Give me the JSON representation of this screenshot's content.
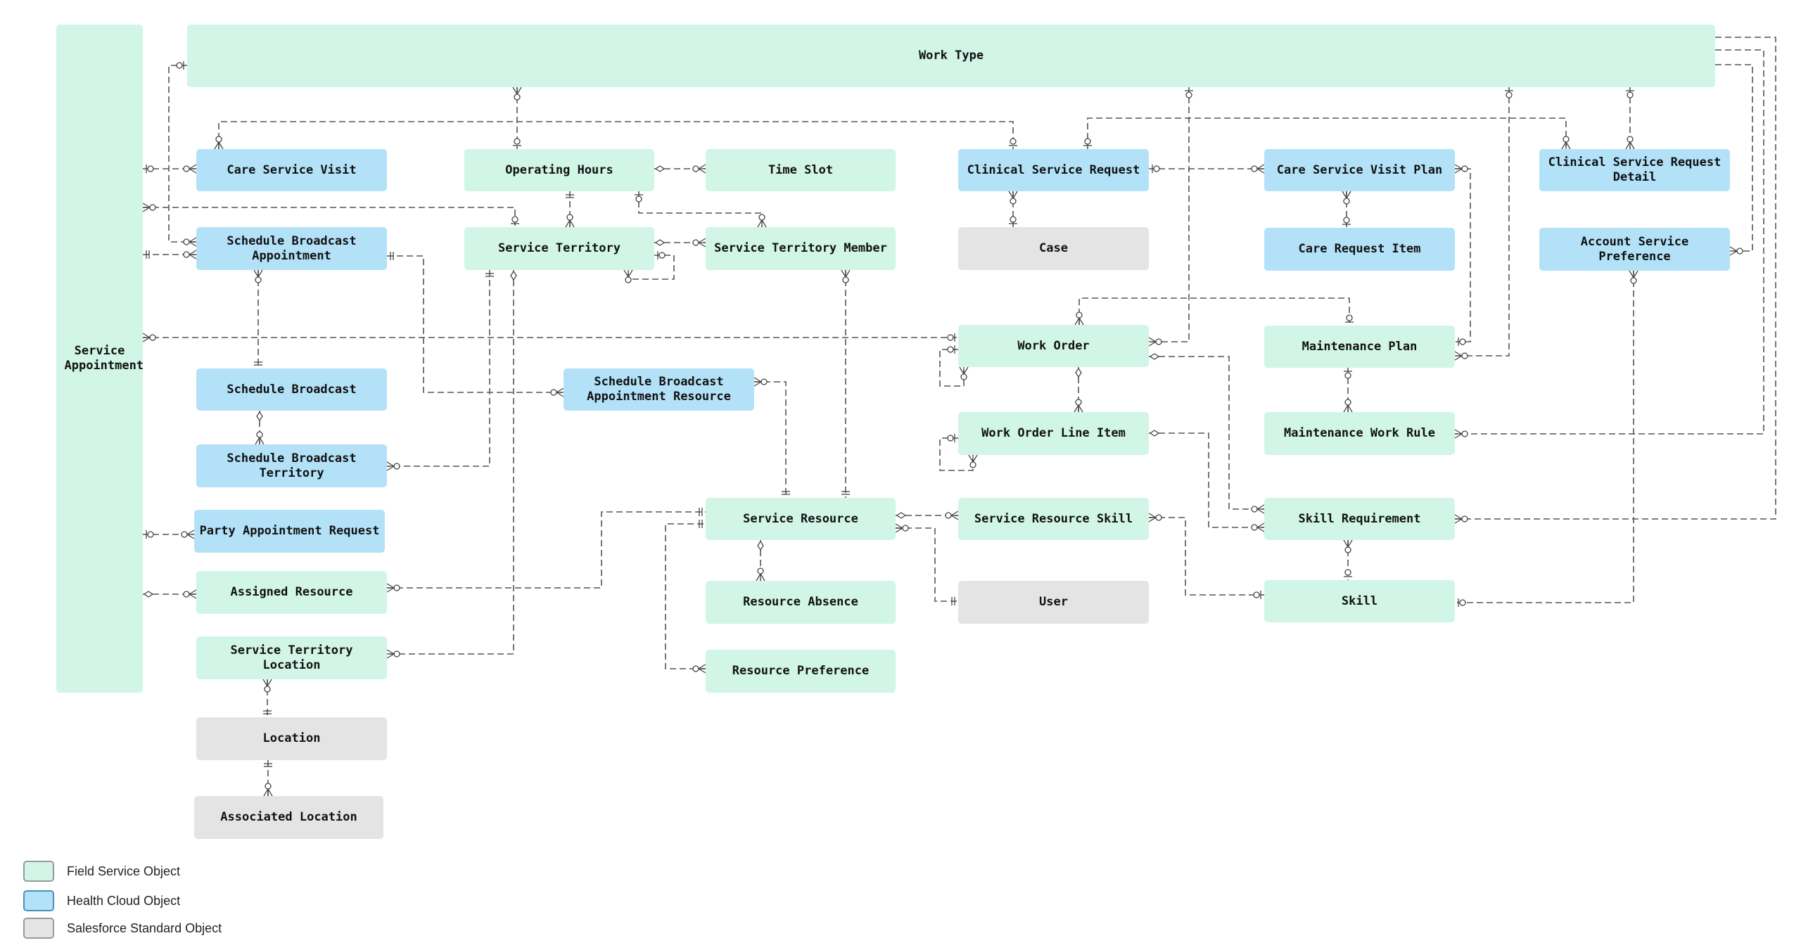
{
  "diagram": {
    "type": "entity-relationship",
    "entities": {
      "service_appointment": {
        "label": "Service Appointment",
        "category": "field_service"
      },
      "work_type": {
        "label": "Work Type",
        "category": "field_service"
      },
      "care_service_visit": {
        "label": "Care Service Visit",
        "category": "health_cloud"
      },
      "operating_hours": {
        "label": "Operating Hours",
        "category": "field_service"
      },
      "time_slot": {
        "label": "Time Slot",
        "category": "field_service"
      },
      "clinical_service_request": {
        "label": "Clinical Service Request",
        "category": "health_cloud"
      },
      "care_service_visit_plan": {
        "label": "Care Service Visit Plan",
        "category": "health_cloud"
      },
      "clinical_service_request_detail": {
        "label": "Clinical Service Request Detail",
        "category": "health_cloud"
      },
      "schedule_broadcast_appointment": {
        "label": "Schedule Broadcast Appointment",
        "category": "health_cloud"
      },
      "service_territory": {
        "label": "Service Territory",
        "category": "field_service"
      },
      "service_territory_member": {
        "label": "Service Territory Member",
        "category": "field_service"
      },
      "case": {
        "label": "Case",
        "category": "salesforce_standard"
      },
      "care_request_item": {
        "label": "Care Request Item",
        "category": "health_cloud"
      },
      "account_service_preference": {
        "label": "Account Service Preference",
        "category": "health_cloud"
      },
      "work_order": {
        "label": "Work Order",
        "category": "field_service"
      },
      "maintenance_plan": {
        "label": "Maintenance Plan",
        "category": "field_service"
      },
      "schedule_broadcast": {
        "label": "Schedule Broadcast",
        "category": "health_cloud"
      },
      "schedule_broadcast_appointment_resource": {
        "label": "Schedule Broadcast Appointment Resource",
        "category": "health_cloud"
      },
      "work_order_line_item": {
        "label": "Work Order Line Item",
        "category": "field_service"
      },
      "maintenance_work_rule": {
        "label": "Maintenance Work Rule",
        "category": "field_service"
      },
      "schedule_broadcast_territory": {
        "label": "Schedule Broadcast Territory",
        "category": "health_cloud"
      },
      "party_appointment_request": {
        "label": "Party Appointment Request",
        "category": "health_cloud"
      },
      "service_resource": {
        "label": "Service Resource",
        "category": "field_service"
      },
      "service_resource_skill": {
        "label": "Service Resource Skill",
        "category": "field_service"
      },
      "skill_requirement": {
        "label": "Skill Requirement",
        "category": "field_service"
      },
      "assigned_resource": {
        "label": "Assigned Resource",
        "category": "field_service"
      },
      "resource_absence": {
        "label": "Resource Absence",
        "category": "field_service"
      },
      "user": {
        "label": "User",
        "category": "salesforce_standard"
      },
      "skill": {
        "label": "Skill",
        "category": "field_service"
      },
      "service_territory_location": {
        "label": "Service Territory Location",
        "category": "field_service"
      },
      "resource_preference": {
        "label": "Resource Preference",
        "category": "field_service"
      },
      "location": {
        "label": "Location",
        "category": "salesforce_standard"
      },
      "associated_location": {
        "label": "Associated Location",
        "category": "salesforce_standard"
      }
    },
    "relationships": [
      {
        "from": "work_type",
        "to": "service_appointment",
        "from_card": "zero-or-one",
        "to_card": "zero-or-many"
      },
      {
        "from": "service_appointment",
        "to": "care_service_visit",
        "from_card": "zero-or-one",
        "to_card": "zero-or-many"
      },
      {
        "from": "work_type",
        "to": "schedule_broadcast_appointment",
        "from_card": "zero-or-one",
        "to_card": "zero-or-many"
      },
      {
        "from": "service_appointment",
        "to": "schedule_broadcast_appointment",
        "from_card": "one",
        "to_card": "zero-or-many"
      },
      {
        "from": "service_appointment",
        "to": "service_territory",
        "from_card": "zero-or-many",
        "to_card": "zero-or-one"
      },
      {
        "from": "service_appointment",
        "to": "work_order",
        "from_card": "zero-or-many",
        "to_card": "zero-or-one"
      },
      {
        "from": "service_appointment",
        "to": "party_appointment_request",
        "from_card": "zero-or-one",
        "to_card": "zero-or-many"
      },
      {
        "from": "service_appointment",
        "to": "assigned_resource",
        "from_card": "zero-or-one",
        "to_card": "zero-or-many"
      },
      {
        "from": "work_type",
        "to": "operating_hours",
        "from_card": "zero-or-many",
        "to_card": "zero-or-one"
      },
      {
        "from": "clinical_service_request",
        "to": "care_service_visit",
        "from_card": "zero-or-one",
        "to_card": "zero-or-many"
      },
      {
        "from": "operating_hours",
        "to": "time_slot",
        "from_card": "zero-or-one",
        "to_card": "zero-or-many"
      },
      {
        "from": "operating_hours",
        "to": "service_territory",
        "from_card": "one",
        "to_card": "zero-or-many"
      },
      {
        "from": "operating_hours",
        "to": "service_territory_member",
        "from_card": "zero-or-one",
        "to_card": "zero-or-many"
      },
      {
        "from": "service_territory",
        "to": "service_territory_member",
        "from_card": "zero-or-one",
        "to_card": "zero-or-many"
      },
      {
        "from": "service_territory",
        "to": "service_territory",
        "from_card": "zero-or-one",
        "to_card": "zero-or-many"
      },
      {
        "from": "schedule_broadcast_appointment",
        "to": "schedule_broadcast",
        "from_card": "zero-or-many",
        "to_card": "one"
      },
      {
        "from": "schedule_broadcast_appointment",
        "to": "schedule_broadcast_appointment_resource",
        "from_card": "one",
        "to_card": "zero-or-many"
      },
      {
        "from": "schedule_broadcast",
        "to": "schedule_broadcast_territory",
        "from_card": "zero-or-one",
        "to_card": "zero-or-many"
      },
      {
        "from": "service_territory",
        "to": "schedule_broadcast_territory",
        "from_card": "one",
        "to_card": "zero-or-many"
      },
      {
        "from": "service_territory",
        "to": "service_territory_location",
        "from_card": "zero-or-one",
        "to_card": "zero-or-many"
      },
      {
        "from": "service_territory_location",
        "to": "location",
        "from_card": "zero-or-many",
        "to_card": "one"
      },
      {
        "from": "location",
        "to": "associated_location",
        "from_card": "one",
        "to_card": "zero-or-many"
      },
      {
        "from": "service_territory_member",
        "to": "service_resource",
        "from_card": "zero-or-many",
        "to_card": "one"
      },
      {
        "from": "schedule_broadcast_appointment_resource",
        "to": "service_resource",
        "from_card": "zero-or-many",
        "to_card": "one"
      },
      {
        "from": "assigned_resource",
        "to": "service_resource",
        "from_card": "zero-or-many",
        "to_card": "one"
      },
      {
        "from": "resource_preference",
        "to": "service_resource",
        "from_card": "zero-or-many",
        "to_card": "one"
      },
      {
        "from": "service_resource",
        "to": "resource_absence",
        "from_card": "zero-or-one",
        "to_card": "zero-or-many"
      },
      {
        "from": "service_resource",
        "to": "service_resource_skill",
        "from_card": "zero-or-one",
        "to_card": "zero-or-many"
      },
      {
        "from": "service_resource",
        "to": "user",
        "from_card": "zero-or-many",
        "to_card": "one"
      },
      {
        "from": "service_resource_skill",
        "to": "skill",
        "from_card": "zero-or-many",
        "to_card": "zero-or-one"
      },
      {
        "from": "clinical_service_request",
        "to": "case",
        "from_card": "zero-or-many",
        "to_card": "zero-or-one"
      },
      {
        "from": "clinical_service_request",
        "to": "care_service_visit_plan",
        "from_card": "zero-or-one",
        "to_card": "zero-or-many"
      },
      {
        "from": "clinical_service_request",
        "to": "clinical_service_request_detail",
        "from_card": "zero-or-one",
        "to_card": "zero-or-many"
      },
      {
        "from": "work_type",
        "to": "clinical_service_request_detail",
        "from_card": "zero-or-one",
        "to_card": "zero-or-many"
      },
      {
        "from": "care_service_visit_plan",
        "to": "care_request_item",
        "from_card": "zero-or-many",
        "to_card": "zero-or-one"
      },
      {
        "from": "care_service_visit_plan",
        "to": "maintenance_plan",
        "from_card": "zero-or-many",
        "to_card": "zero-or-one"
      },
      {
        "from": "work_type",
        "to": "work_order",
        "from_card": "zero-or-one",
        "to_card": "zero-or-many"
      },
      {
        "from": "work_type",
        "to": "maintenance_plan",
        "from_card": "zero-or-one",
        "to_card": "zero-or-many"
      },
      {
        "from": "work_type",
        "to": "account_service_preference",
        "from_card": "zero-or-one",
        "to_card": "zero-or-many"
      },
      {
        "from": "work_type",
        "to": "maintenance_work_rule",
        "from_card": "zero-or-one",
        "to_card": "zero-or-many"
      },
      {
        "from": "work_type",
        "to": "skill_requirement",
        "from_card": "zero-or-one",
        "to_card": "zero-or-many"
      },
      {
        "from": "maintenance_plan",
        "to": "work_order",
        "from_card": "zero-or-one",
        "to_card": "zero-or-many"
      },
      {
        "from": "maintenance_plan",
        "to": "maintenance_work_rule",
        "from_card": "zero-or-one",
        "to_card": "zero-or-many"
      },
      {
        "from": "work_order",
        "to": "work_order",
        "from_card": "zero-or-one",
        "to_card": "zero-or-many"
      },
      {
        "from": "work_order",
        "to": "work_order_line_item",
        "from_card": "zero-or-one",
        "to_card": "zero-or-many"
      },
      {
        "from": "work_order_line_item",
        "to": "work_order_line_item",
        "from_card": "zero-or-one",
        "to_card": "zero-or-many"
      },
      {
        "from": "work_order",
        "to": "skill_requirement",
        "from_card": "zero-or-one",
        "to_card": "zero-or-many"
      },
      {
        "from": "work_order_line_item",
        "to": "skill_requirement",
        "from_card": "zero-or-one",
        "to_card": "zero-or-many"
      },
      {
        "from": "skill_requirement",
        "to": "skill",
        "from_card": "zero-or-many",
        "to_card": "zero-or-one"
      },
      {
        "from": "account_service_preference",
        "to": "skill",
        "from_card": "zero-or-many",
        "to_card": "zero-or-one"
      }
    ]
  },
  "legend": {
    "items": [
      {
        "label": "Field Service Object",
        "color": "#d1f5e6"
      },
      {
        "label": "Health Cloud Object",
        "color": "#b3e2f8"
      },
      {
        "label": "Salesforce Standard Object",
        "color": "#e4e4e4"
      }
    ]
  },
  "colors": {
    "field_service": "#d1f5e6",
    "health_cloud": "#b3e2f8",
    "salesforce_standard": "#e4e4e4",
    "connector": "#555555"
  }
}
